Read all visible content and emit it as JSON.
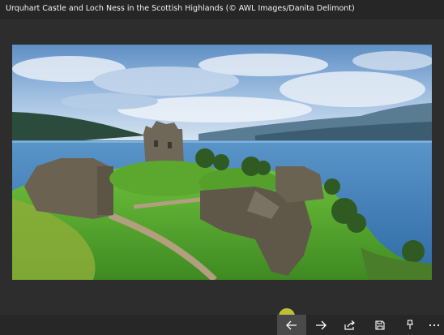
{
  "window": {
    "title": "Urquhart Castle and Loch Ness in the Scottish Highlands (© AWL Images/Danita Delimont)"
  },
  "photo": {
    "palette": {
      "sky": "#8fb4dc",
      "cloud": "#dfe8f3",
      "loch": "#3b78b3",
      "hills": "#2a4a3a",
      "grass": "#5fae32",
      "stone": "#6b6252"
    }
  },
  "commandbar": {
    "buttons": [
      {
        "name": "back-button",
        "icon": "arrow-left-icon"
      },
      {
        "name": "forward-button",
        "icon": "arrow-right-icon"
      },
      {
        "name": "share-button",
        "icon": "share-icon"
      },
      {
        "name": "save-button",
        "icon": "save-icon"
      },
      {
        "name": "set-lockscreen-button",
        "icon": "pin-icon"
      },
      {
        "name": "more-button",
        "icon": "more-icon"
      }
    ]
  }
}
